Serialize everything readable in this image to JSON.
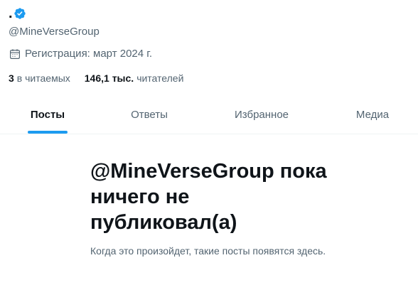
{
  "profile": {
    "display_name": ".",
    "handle": "@MineVerseGroup",
    "joined": "Регистрация: март 2024 г.",
    "following": {
      "count": "3",
      "label": "в читаемых"
    },
    "followers": {
      "count": "146,1 тыс.",
      "label": "читателей"
    }
  },
  "tabs": [
    {
      "label": "Посты",
      "active": true
    },
    {
      "label": "Ответы",
      "active": false
    },
    {
      "label": "Избранное",
      "active": false
    },
    {
      "label": "Медиа",
      "active": false
    }
  ],
  "empty_state": {
    "title": "@MineVerseGroup пока ничего не публиковал(а)",
    "text": "Когда это произойдет, такие посты появятся здесь."
  },
  "colors": {
    "accent": "#1d9bf0",
    "text_primary": "#0f1419",
    "text_secondary": "#536471",
    "divider": "#eff3f4"
  },
  "icons": [
    "verified-badge-icon",
    "calendar-icon"
  ]
}
